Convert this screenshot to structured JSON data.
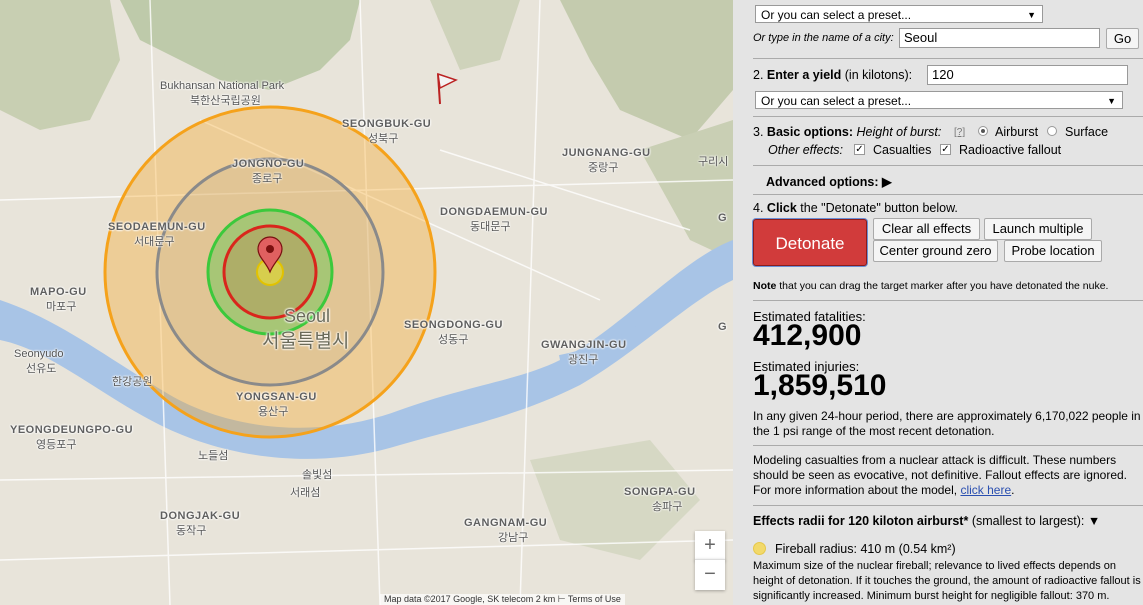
{
  "map": {
    "labels": {
      "bukhansan_en": "Bukhansan National Park",
      "bukhansan_kr": "북한산국립공원",
      "seongbuk_en": "SEONGBUK-GU",
      "seongbuk_kr": "성북구",
      "jongno_en": "JONGNO-GU",
      "jongno_kr": "종로구",
      "jungnang_en": "JUNGNANG-GU",
      "jungnang_kr": "중랑구",
      "guri_kr": "구리시",
      "dongdaemun_en": "DONGDAEMUN-GU",
      "dongdaemun_kr": "동대문구",
      "seodaemun_en": "SEODAEMUN-GU",
      "seodaemun_kr": "서대문구",
      "mapo_en": "MAPO-GU",
      "mapo_kr": "마포구",
      "seoul_en": "Seoul",
      "seoul_kr": "서울특별시",
      "seongdong_en": "SEONGDONG-GU",
      "seongdong_kr": "성동구",
      "gwangjin_en": "GWANGJIN-GU",
      "gwangjin_kr": "광진구",
      "seonyudo_en": "Seonyudo",
      "seonyudo_kr": "선유도",
      "hangang_kr": "한강공원",
      "yongsan_en": "YONGSAN-GU",
      "yongsan_kr": "용산구",
      "yeongdeungpo_en": "YEONGDEUNGPO-GU",
      "yeongdeungpo_kr": "영등포구",
      "noryang_kr": "노들섬",
      "seorae_kr": "솔빛섬",
      "seorae2_kr": "서래섬",
      "songpa_en": "SONGPA-GU",
      "songpa_kr": "송파구",
      "gangnam_en": "GANGNAM-GU",
      "gangnam_kr": "강남구",
      "dongjak_en": "DONGJAK-GU",
      "dongjak_kr": "동작구",
      "edge_g": "G",
      "edge_g2": "G"
    },
    "zoom_in": "+",
    "zoom_out": "−",
    "attribution": "Map data ©2017 Google, SK telecom   2 km ⊢      Terms of Use",
    "colors": {
      "outer_ring": "#f5a21b",
      "gray_ring": "#8a8a8a",
      "green_ring": "#3cc93c",
      "red_ring": "#d9261c",
      "fireball": "#f2e33c",
      "water": "#a8c4e6"
    }
  },
  "panel": {
    "step1": {
      "preset_select": "Or you can select a preset...",
      "city_label": "Or type in the name of a city:",
      "city_value": "Seoul",
      "go_button": "Go"
    },
    "step2": {
      "number": "2.",
      "label_bold": "Enter a yield",
      "label_rest": "(in kilotons):",
      "yield_value": "120",
      "preset_select": "Or you can select a preset..."
    },
    "step3": {
      "number": "3.",
      "label_bold": "Basic options:",
      "height_label": "Height of burst:",
      "help": "[?]",
      "airburst": "Airburst",
      "surface": "Surface",
      "other_label": "Other effects:",
      "casualties": "Casualties",
      "fallout": "Radioactive fallout"
    },
    "advanced": "Advanced options:",
    "step4": {
      "number": "4.",
      "label_bold": "Click",
      "label_rest": "the \"Detonate\" button below.",
      "detonate": "Detonate",
      "clear_all": "Clear all effects",
      "launch_multiple": "Launch multiple",
      "center_ground_zero": "Center ground zero",
      "probe_location": "Probe location"
    },
    "note_bold": "Note",
    "note_rest": "that you can drag the target marker after you have detonated the nuke.",
    "fatalities_label": "Estimated fatalities:",
    "fatalities_value": "412,900",
    "injuries_label": "Estimated injuries:",
    "injuries_value": "1,859,510",
    "psi_text": "In any given 24-hour period, there are approximately 6,170,022 people in the 1 psi range of the most recent detonation.",
    "modeling_text": "Modeling casualties from a nuclear attack is difficult. These numbers should be seen as evocative, not definitive. Fallout effects are ignored. For more information about the model,",
    "click_here": "click here",
    "modeling_end": ".",
    "effects_header_bold": "Effects radii for 120 kiloton airburst*",
    "effects_header_rest": "(smallest to largest):",
    "effects_toggle": "▼",
    "fireball_label": "Fireball radius:",
    "fireball_value": "410 m (0.54 km²)",
    "fireball_desc": "Maximum size of the nuclear fireball; relevance to lived effects depends on height of detonation. If it touches the ground, the amount of radioactive fallout is significantly increased. Minimum burst height for negligible fallout: 370 m."
  }
}
